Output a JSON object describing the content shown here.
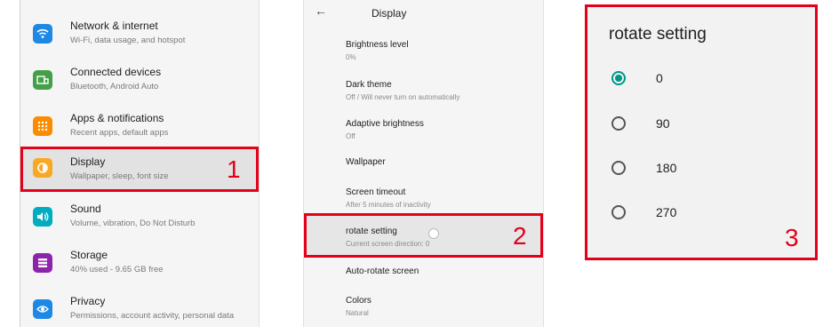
{
  "settings": {
    "items": [
      {
        "title": "Network & internet",
        "subtitle": "Wi-Fi, data usage, and hotspot",
        "icon": "wifi-icon",
        "color": "#1e88e5"
      },
      {
        "title": "Connected devices",
        "subtitle": "Bluetooth, Android Auto",
        "icon": "connected-devices-icon",
        "color": "#43a047"
      },
      {
        "title": "Apps & notifications",
        "subtitle": "Recent apps, default apps",
        "icon": "apps-icon",
        "color": "#fb8c00"
      },
      {
        "title": "Display",
        "subtitle": "Wallpaper, sleep, font size",
        "icon": "display-icon",
        "color": "#f9a825"
      },
      {
        "title": "Sound",
        "subtitle": "Volume, vibration, Do Not Disturb",
        "icon": "sound-icon",
        "color": "#00acc1"
      },
      {
        "title": "Storage",
        "subtitle": "40% used - 9.65 GB free",
        "icon": "storage-icon",
        "color": "#8e24aa"
      },
      {
        "title": "Privacy",
        "subtitle": "Permissions, account activity, personal data",
        "icon": "privacy-icon",
        "color": "#1e88e5"
      }
    ]
  },
  "display": {
    "back_icon": "←",
    "title": "Display",
    "items": [
      {
        "title": "Brightness level",
        "subtitle": "0%"
      },
      {
        "title": "Dark theme",
        "subtitle": "Off / Will never turn on automatically"
      },
      {
        "title": "Adaptive brightness",
        "subtitle": "Off"
      },
      {
        "title": "Wallpaper",
        "subtitle": ""
      },
      {
        "title": "Screen timeout",
        "subtitle": "After 5 minutes of inactivity"
      },
      {
        "title": "rotate setting",
        "subtitle": "Current screen direction: 0"
      },
      {
        "title": "Auto-rotate screen",
        "subtitle": ""
      },
      {
        "title": "Colors",
        "subtitle": "Natural"
      }
    ]
  },
  "dialog": {
    "title": "rotate setting",
    "options": [
      "0",
      "90",
      "180",
      "270"
    ],
    "selected": "0"
  },
  "callouts": [
    "1",
    "2",
    "3"
  ],
  "colors": {
    "highlight": "#e3001b",
    "radio_accent": "#009688"
  }
}
